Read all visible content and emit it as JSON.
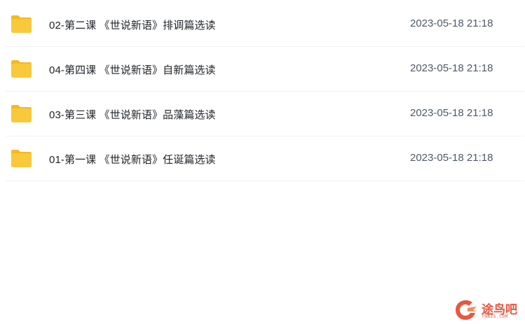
{
  "files": [
    {
      "name": "02-第二课 《世说新语》排调篇选读",
      "date": "2023-05-18 21:18",
      "icon": "folder-icon"
    },
    {
      "name": "04-第四课 《世说新语》自新篇选读",
      "date": "2023-05-18 21:18",
      "icon": "folder-icon"
    },
    {
      "name": "03-第三课 《世说新语》品藻篇选读",
      "date": "2023-05-18 21:18",
      "icon": "folder-icon"
    },
    {
      "name": "01-第一课 《世说新语》任诞篇选读",
      "date": "2023-05-18 21:18",
      "icon": "folder-icon"
    }
  ],
  "watermark": {
    "text": "途鸟吧",
    "sub": "TNBZS.COM",
    "color": "#e9573f"
  },
  "colors": {
    "folder_body": "#f9c93c",
    "folder_tab": "#f5b91f",
    "divider": "#eef0f3"
  }
}
